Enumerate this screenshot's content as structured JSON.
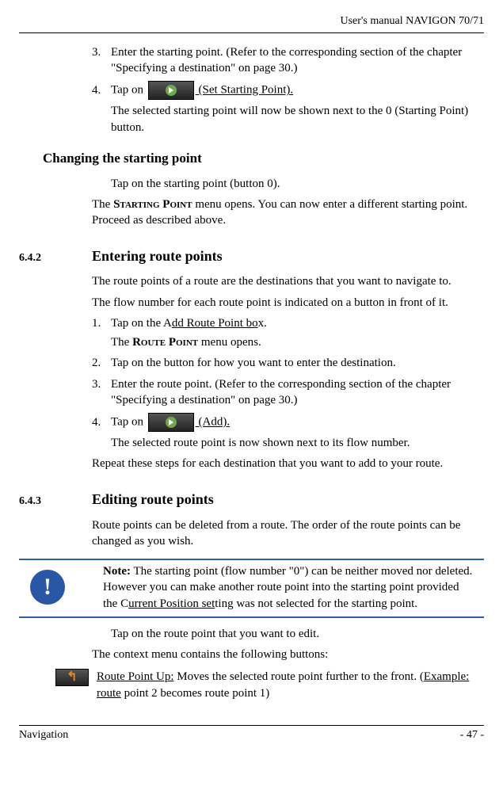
{
  "header": {
    "title": "User's manual NAVIGON 70/71"
  },
  "footer": {
    "left": "Navigation",
    "right": "- 47 -"
  },
  "intro": {
    "step3_num": "3.",
    "step3": "Enter the starting point. (Refer to the corresponding section of the chapter \"Specifying a destination\" on page 30.)",
    "step4_num": "4.",
    "step4_pre": "Tap on ",
    "step4_link": " (Set Starting Point).",
    "step4_after": "The selected starting point will now be shown next to the 0 (Starting Point) button."
  },
  "change": {
    "heading": "Changing the starting point",
    "line1": "Tap on the starting point (button 0).",
    "line2a": "The ",
    "line2b_sc": "Starting Point",
    "line2c": " menu opens. You can now enter a different starting point. Proceed as described above."
  },
  "s642": {
    "num": "6.4.2",
    "title": "Entering route points",
    "p1": "The route points of a route are the destinations that you want to navigate to.",
    "p2": "The flow number for each route point is indicated on a button in front of it.",
    "step1_num": "1.",
    "step1_pre": "Tap on the A",
    "step1_u": "dd Route Point bo",
    "step1_post": "x.",
    "step1_after_a": "The ",
    "step1_after_sc": "Route Point",
    "step1_after_b": " menu opens.",
    "step2_num": "2.",
    "step2": "Tap on the button for how you want to enter the destination.",
    "step3_num": "3.",
    "step3": "Enter the route point. (Refer to the corresponding section of the chapter \"Specifying a destination\" on page 30.)",
    "step4_num": "4.",
    "step4_pre": "Tap on ",
    "step4_link": " (Add).",
    "step4_after": "The selected route point is now shown next to its flow number.",
    "p3": "Repeat these steps for each destination that you want to add to your route."
  },
  "s643": {
    "num": "6.4.3",
    "title": "Editing route points",
    "p1": "Route points can be deleted from a route. The order of the route points can be changed as you wish.",
    "note_label": "Note:",
    "note_a": " The starting point (flow number \"0\") can be neither moved nor deleted. However you can make another route point into the starting point provided the C",
    "note_u": "urrent Position set",
    "note_b": "ting was not selected for the starting point.",
    "line1": "Tap on the route point that you want to edit.",
    "line2": "The context menu contains the following buttons:",
    "btn_pre": " ",
    "btn_u": "Route Point Up:",
    "btn_post_a": " Moves the selected route point further to the front. (",
    "btn_post_u": "Example: route",
    "btn_post_b": " point 2 becomes route point 1)"
  }
}
